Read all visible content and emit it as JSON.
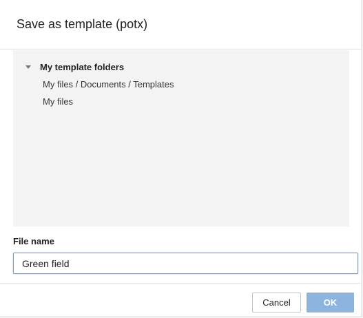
{
  "dialog": {
    "title": "Save as template (potx)"
  },
  "folders": {
    "root_label": "My template folders",
    "items": [
      {
        "label": "My files / Documents / Templates"
      },
      {
        "label": "My files"
      }
    ]
  },
  "file_name": {
    "label": "File name",
    "value": "Green field"
  },
  "buttons": {
    "cancel_label": "Cancel",
    "ok_label": "OK"
  },
  "colors": {
    "accent": "#8eb4de",
    "focus_border": "#6aa3d9",
    "panel_bg": "#f3f3f3"
  },
  "icons": {
    "root_toggle": "caret-down-icon"
  }
}
